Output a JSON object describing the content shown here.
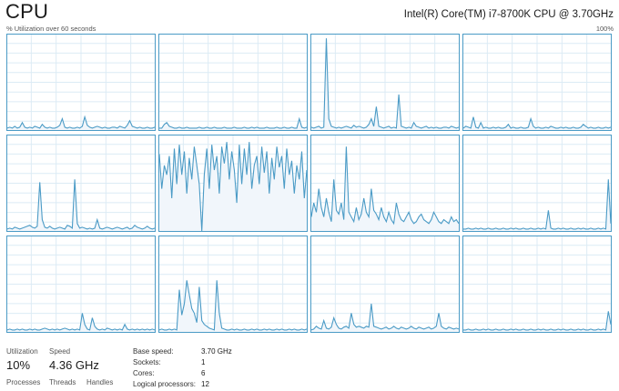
{
  "header": {
    "title": "CPU",
    "cpu_model": "Intel(R) Core(TM) i7-8700K CPU @ 3.70GHz",
    "utilization_caption": "% Utilization over 60 seconds",
    "max_label": "100%"
  },
  "colors": {
    "graph_line": "#4b9bc6",
    "graph_fill": "#f1f6fb",
    "graph_grid": "#dcebf5",
    "graph_border": "#4b9bc6"
  },
  "stats": {
    "utilization_label": "Utilization",
    "utilization_value": "10%",
    "speed_label": "Speed",
    "speed_value": "4.36 GHz",
    "processes_label": "Processes",
    "threads_label": "Threads",
    "handles_label": "Handles"
  },
  "details": [
    {
      "label": "Base speed:",
      "value": "3.70 GHz"
    },
    {
      "label": "Sockets:",
      "value": "1"
    },
    {
      "label": "Cores:",
      "value": "6"
    },
    {
      "label": "Logical processors:",
      "value": "12"
    }
  ],
  "cores": [
    {
      "utilization": [
        2,
        3,
        2,
        4,
        2,
        3,
        8,
        3,
        2,
        3,
        2,
        4,
        3,
        2,
        6,
        3,
        2,
        3,
        2,
        2,
        3,
        5,
        12,
        3,
        2,
        3,
        2,
        2,
        3,
        2,
        4,
        14,
        5,
        3,
        2,
        3,
        4,
        3,
        2,
        3,
        2,
        2,
        3,
        3,
        2,
        4,
        3,
        2,
        5,
        10,
        4,
        3,
        2,
        3,
        2,
        2,
        3,
        2,
        2,
        3
      ]
    },
    {
      "utilization": [
        2,
        2,
        6,
        8,
        4,
        3,
        2,
        2,
        3,
        2,
        2,
        3,
        2,
        2,
        2,
        2,
        3,
        2,
        2,
        3,
        2,
        2,
        3,
        2,
        2,
        2,
        3,
        2,
        2,
        2,
        3,
        2,
        2,
        2,
        3,
        2,
        2,
        3,
        2,
        3,
        2,
        2,
        2,
        3,
        2,
        2,
        2,
        3,
        2,
        2,
        3,
        2,
        2,
        3,
        2,
        2,
        12,
        3,
        2,
        3
      ]
    },
    {
      "utilization": [
        3,
        2,
        3,
        4,
        2,
        3,
        98,
        12,
        4,
        3,
        2,
        3,
        2,
        3,
        4,
        3,
        2,
        5,
        3,
        4,
        3,
        2,
        3,
        6,
        12,
        4,
        25,
        4,
        3,
        2,
        3,
        4,
        2,
        3,
        2,
        38,
        4,
        3,
        2,
        3,
        2,
        8,
        4,
        3,
        2,
        3,
        4,
        2,
        3,
        2,
        3,
        2,
        2,
        3,
        3,
        2,
        4,
        3,
        2,
        3
      ]
    },
    {
      "utilization": [
        2,
        4,
        3,
        2,
        14,
        3,
        2,
        8,
        2,
        3,
        2,
        2,
        3,
        2,
        3,
        2,
        2,
        3,
        6,
        2,
        3,
        2,
        2,
        3,
        2,
        2,
        3,
        12,
        4,
        2,
        3,
        2,
        2,
        3,
        2,
        4,
        3,
        2,
        2,
        3,
        2,
        3,
        2,
        2,
        3,
        2,
        2,
        3,
        6,
        4,
        2,
        3,
        2,
        2,
        3,
        2,
        2,
        3,
        2,
        3
      ]
    },
    {
      "utilization": [
        2,
        3,
        2,
        4,
        3,
        2,
        3,
        4,
        5,
        6,
        4,
        3,
        5,
        52,
        12,
        4,
        3,
        5,
        3,
        2,
        3,
        4,
        3,
        2,
        6,
        5,
        3,
        55,
        8,
        3,
        4,
        3,
        2,
        3,
        2,
        3,
        12,
        3,
        2,
        3,
        4,
        3,
        2,
        3,
        4,
        3,
        2,
        3,
        4,
        2,
        3,
        6,
        4,
        3,
        2,
        3,
        5,
        3,
        2,
        3
      ]
    },
    {
      "utilization": [
        82,
        45,
        70,
        60,
        80,
        35,
        88,
        50,
        92,
        60,
        85,
        40,
        78,
        55,
        90,
        70,
        50,
        0,
        60,
        88,
        45,
        92,
        65,
        80,
        40,
        90,
        72,
        95,
        55,
        85,
        65,
        30,
        92,
        50,
        88,
        60,
        95,
        45,
        70,
        80,
        50,
        90,
        62,
        85,
        40,
        78,
        55,
        90,
        68,
        80,
        45,
        88,
        60,
        75,
        40,
        70,
        55,
        85,
        35,
        65
      ]
    },
    {
      "utilization": [
        15,
        30,
        20,
        45,
        25,
        15,
        35,
        20,
        10,
        55,
        22,
        18,
        30,
        12,
        90,
        20,
        15,
        10,
        25,
        12,
        18,
        35,
        20,
        15,
        45,
        22,
        18,
        12,
        25,
        15,
        10,
        20,
        12,
        8,
        30,
        18,
        12,
        10,
        15,
        20,
        12,
        8,
        10,
        15,
        18,
        12,
        10,
        8,
        12,
        20,
        15,
        10,
        8,
        12,
        10,
        8,
        15,
        10,
        12,
        8
      ]
    },
    {
      "utilization": [
        2,
        2,
        3,
        2,
        2,
        3,
        2,
        3,
        2,
        2,
        3,
        2,
        2,
        3,
        2,
        2,
        3,
        2,
        2,
        3,
        2,
        3,
        2,
        2,
        3,
        2,
        2,
        3,
        2,
        2,
        3,
        2,
        3,
        2,
        22,
        3,
        2,
        2,
        3,
        2,
        3,
        2,
        2,
        3,
        2,
        2,
        3,
        2,
        3,
        2,
        2,
        3,
        2,
        2,
        3,
        2,
        3,
        2,
        55,
        8
      ]
    },
    {
      "utilization": [
        2,
        3,
        2,
        2,
        3,
        2,
        3,
        2,
        2,
        3,
        2,
        3,
        2,
        2,
        3,
        4,
        3,
        2,
        3,
        2,
        3,
        2,
        3,
        4,
        3,
        2,
        3,
        2,
        3,
        2,
        20,
        8,
        3,
        2,
        15,
        6,
        3,
        2,
        3,
        2,
        4,
        3,
        2,
        3,
        2,
        3,
        2,
        8,
        3,
        2,
        3,
        2,
        3,
        2,
        3,
        2,
        3,
        2,
        3,
        2
      ]
    },
    {
      "utilization": [
        2,
        3,
        2,
        2,
        3,
        2,
        3,
        2,
        45,
        18,
        30,
        55,
        40,
        25,
        20,
        10,
        48,
        12,
        8,
        6,
        4,
        3,
        2,
        55,
        20,
        4,
        3,
        2,
        2,
        3,
        2,
        3,
        2,
        2,
        3,
        2,
        2,
        3,
        2,
        3,
        2,
        2,
        3,
        2,
        3,
        2,
        2,
        3,
        2,
        3,
        2,
        2,
        3,
        2,
        3,
        2,
        2,
        3,
        2,
        3
      ]
    },
    {
      "utilization": [
        2,
        3,
        6,
        4,
        3,
        12,
        4,
        3,
        5,
        15,
        8,
        4,
        3,
        5,
        6,
        4,
        20,
        8,
        5,
        6,
        5,
        4,
        6,
        5,
        30,
        6,
        5,
        4,
        3,
        4,
        5,
        3,
        4,
        6,
        4,
        3,
        5,
        4,
        3,
        4,
        6,
        4,
        3,
        5,
        4,
        3,
        4,
        5,
        3,
        4,
        6,
        20,
        6,
        4,
        3,
        5,
        4,
        3,
        4,
        3
      ]
    },
    {
      "utilization": [
        2,
        2,
        3,
        2,
        2,
        3,
        2,
        2,
        3,
        2,
        3,
        2,
        2,
        3,
        2,
        2,
        3,
        2,
        2,
        3,
        2,
        3,
        2,
        2,
        3,
        2,
        2,
        3,
        2,
        2,
        3,
        2,
        3,
        2,
        2,
        3,
        2,
        2,
        3,
        2,
        3,
        2,
        2,
        3,
        2,
        2,
        3,
        2,
        3,
        2,
        2,
        3,
        2,
        2,
        3,
        2,
        3,
        2,
        22,
        8
      ]
    }
  ]
}
